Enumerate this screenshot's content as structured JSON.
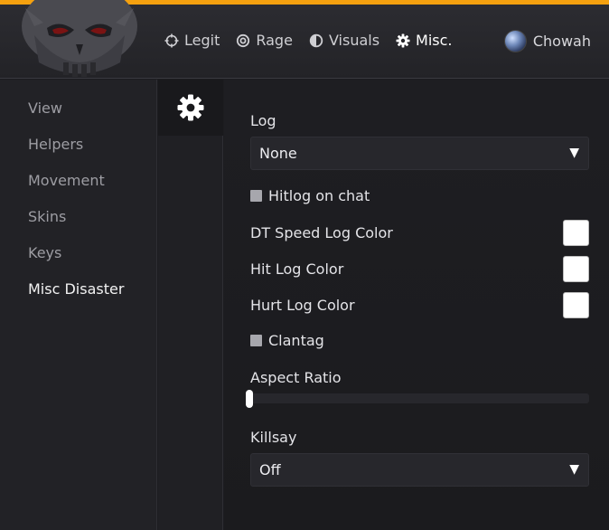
{
  "colors": {
    "accent": "#f5a10f",
    "swatch_white": "#ffffff",
    "checkbox_gray": "#a7a7ad"
  },
  "header": {
    "logo_icon": "skull-logo-icon",
    "tabs": [
      {
        "label": "Legit",
        "icon": "crosshair-icon"
      },
      {
        "label": "Rage",
        "icon": "target-icon"
      },
      {
        "label": "Visuals",
        "icon": "half-circle-icon"
      },
      {
        "label": "Misc.",
        "icon": "gear-icon"
      }
    ],
    "active_tab": "Misc.",
    "user": {
      "name": "Chowah",
      "avatar_icon": "avatar-icon"
    }
  },
  "sidebar": {
    "items": [
      {
        "label": "View"
      },
      {
        "label": "Helpers"
      },
      {
        "label": "Movement"
      },
      {
        "label": "Skins"
      },
      {
        "label": "Keys"
      },
      {
        "label": "Misc Disaster"
      }
    ],
    "active": "Misc Disaster"
  },
  "subtab": {
    "icon": "gear-icon"
  },
  "settings": {
    "log": {
      "label": "Log",
      "value": "None"
    },
    "hitlog_on_chat": {
      "label": "Hitlog on chat",
      "checked": false
    },
    "dt_speed_log_color": {
      "label": "DT Speed Log Color",
      "color": "#ffffff"
    },
    "hit_log_color": {
      "label": "Hit Log Color",
      "color": "#ffffff"
    },
    "hurt_log_color": {
      "label": "Hurt Log Color",
      "color": "#ffffff"
    },
    "clantag": {
      "label": "Clantag",
      "checked": false
    },
    "aspect_ratio": {
      "label": "Aspect Ratio",
      "value_fraction": 0.0
    },
    "killsay": {
      "label": "Killsay",
      "value": "Off"
    },
    "dropdown_caret": "▼"
  }
}
